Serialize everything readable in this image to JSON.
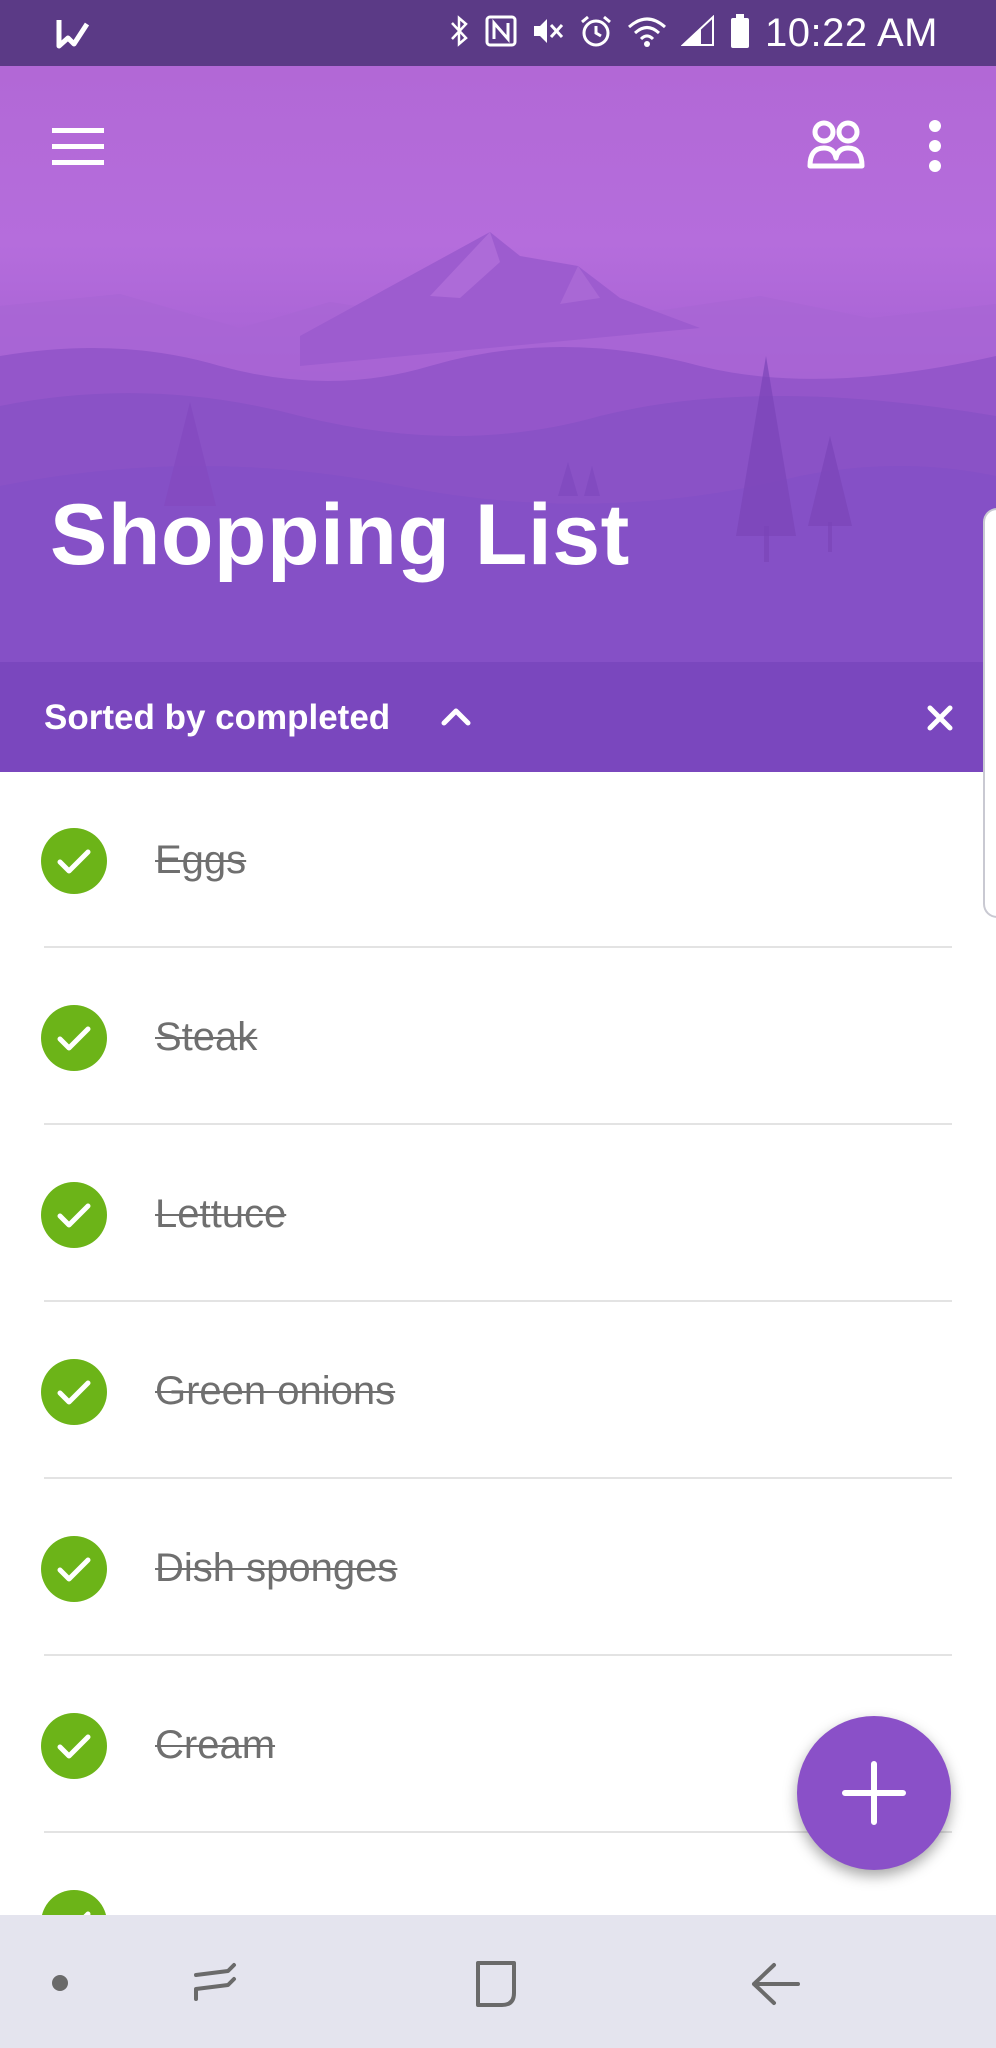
{
  "status_bar": {
    "time": "10:22 AM"
  },
  "header": {
    "title": "Shopping List"
  },
  "sort_bar": {
    "label": "Sorted by completed"
  },
  "list": {
    "items": [
      {
        "label": "Eggs",
        "completed": true
      },
      {
        "label": "Steak",
        "completed": true
      },
      {
        "label": "Lettuce",
        "completed": true
      },
      {
        "label": "Green onions",
        "completed": true
      },
      {
        "label": "Dish sponges",
        "completed": true
      },
      {
        "label": "Cream",
        "completed": true
      }
    ]
  },
  "colors": {
    "accent": "#8a50c8",
    "sort_bar": "#7a47be",
    "status_bar": "#5b3a86",
    "check": "#6cb418"
  },
  "icons": {
    "status_left": "check-flag-icon",
    "menu": "hamburger-menu-icon",
    "share": "people-icon",
    "more": "more-vertical-icon",
    "sort": "chevron-up-icon",
    "close": "close-icon",
    "fab": "plus-icon"
  }
}
